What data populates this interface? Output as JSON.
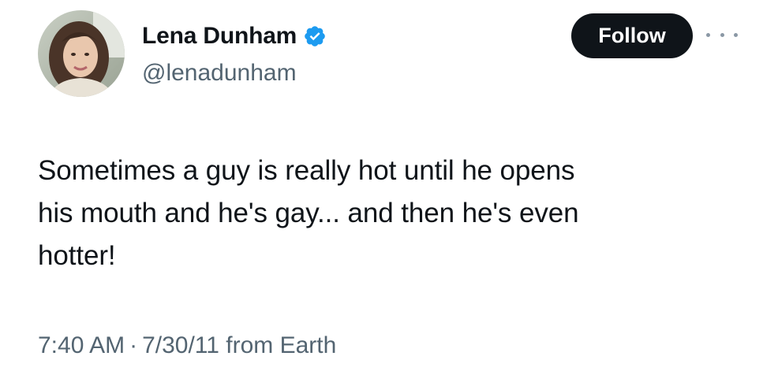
{
  "author": {
    "display_name": "Lena Dunham",
    "handle": "@lenadunham",
    "verified_icon": "verified-badge-icon",
    "verified_color": "#1d9bf0"
  },
  "actions": {
    "follow_label": "Follow",
    "more_icon": "more-options-icon"
  },
  "tweet": {
    "text": "Sometimes a guy is really hot until he opens\nhis mouth and he's gay... and then he's even\nhotter!",
    "time": "7:40 AM",
    "separator": "·",
    "date_source": "7/30/11 from Earth"
  },
  "colors": {
    "text_primary": "#0f1419",
    "text_secondary": "#536471",
    "button_bg": "#0f1419",
    "button_text": "#ffffff"
  }
}
